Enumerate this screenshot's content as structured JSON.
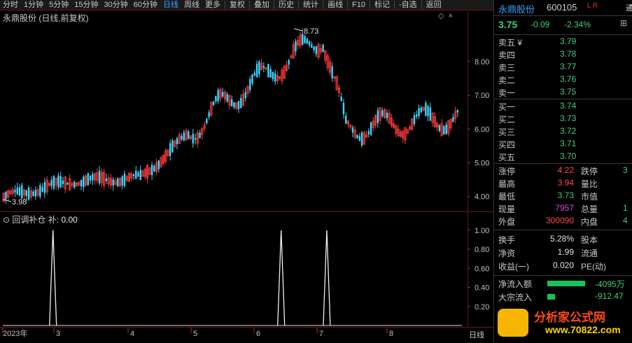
{
  "toolbar": {
    "periods": [
      "分时",
      "1分钟",
      "5分钟",
      "15分钟",
      "30分钟",
      "60分钟",
      "日线",
      "周线",
      "更多"
    ],
    "active_index": 6,
    "actions": [
      "复权",
      "叠加",
      "历史",
      "统计",
      "画线",
      "F10",
      "标记",
      "-自选",
      "返回"
    ]
  },
  "chart": {
    "title": "永鼎股份 (日线,前复权)",
    "high_marker": "8.73",
    "low_marker": "3.98",
    "y_ticks": [
      "8.00",
      "7.00",
      "6.00",
      "5.00",
      "4.00"
    ],
    "x_labels": [
      "2023年",
      "3",
      "4",
      "5",
      "6",
      "7",
      "8"
    ],
    "axis_caption": "日线",
    "colors": {
      "up": "#ff3b3b",
      "down": "#3ad7ff",
      "grid": "#5a1010"
    }
  },
  "indicator": {
    "name": "回调补仓",
    "label": "补:",
    "value": "0.00",
    "y_ticks": [
      "1.00",
      "0.80",
      "0.60",
      "0.40",
      "0.20"
    ]
  },
  "chart_data": [
    {
      "type": "bar",
      "title": "",
      "ylim": [
        3.6,
        9.2
      ],
      "x": [
        "2023-01",
        "2023-03",
        "2023-04",
        "2023-05",
        "2023-06",
        "2023-07",
        "2023-08"
      ],
      "values": [
        3.98,
        4.45,
        4.55,
        6.7,
        8.73,
        6.0,
        6.35
      ],
      "xlabel": "",
      "ylabel": ""
    },
    {
      "type": "line",
      "title": "",
      "ylim": [
        0,
        1.05
      ],
      "spikes": [
        {
          "position": 0.11,
          "value": 1.0
        },
        {
          "position": 0.61,
          "value": 1.0
        },
        {
          "position": 0.71,
          "value": 1.0
        }
      ],
      "xlabel": "",
      "ylabel": ""
    }
  ],
  "quote": {
    "name": "永鼎股份",
    "code": "600105",
    "lr": "L R",
    "extra": "通",
    "price": "3.75",
    "change": "-0.09",
    "pct": "-2.34%",
    "icon": "⊞"
  },
  "orderbook": {
    "asks": [
      {
        "label": "卖五 ¥",
        "price": "3.79"
      },
      {
        "label": "卖四",
        "price": "3.78"
      },
      {
        "label": "卖三",
        "price": "3.77"
      },
      {
        "label": "卖二",
        "price": "3.76"
      },
      {
        "label": "卖一",
        "price": "3.75"
      }
    ],
    "bids": [
      {
        "label": "买一",
        "price": "3.74"
      },
      {
        "label": "买二",
        "price": "3.73"
      },
      {
        "label": "买三",
        "price": "3.72"
      },
      {
        "label": "买四",
        "price": "3.71"
      },
      {
        "label": "买五",
        "price": "3.70"
      }
    ]
  },
  "stats": [
    {
      "l": "涨停",
      "v": "4.22",
      "vc": "red",
      "r": "跌停",
      "rv": "3"
    },
    {
      "l": "最高",
      "v": "3.94",
      "vc": "red",
      "r": "量比",
      "rv": ""
    },
    {
      "l": "最低",
      "v": "3.73",
      "vc": "green",
      "r": "市值",
      "rv": ""
    },
    {
      "l": "现量",
      "v": "7957",
      "vc": "purple",
      "r": "总量",
      "rv": "1"
    },
    {
      "l": "外盘",
      "v": "300090",
      "vc": "red",
      "r": "内盘",
      "rv": "4"
    },
    {
      "l": "换手",
      "v": "5.28%",
      "vc": "white",
      "r": "股本",
      "rv": ""
    },
    {
      "l": "净资",
      "v": "1.99",
      "vc": "white",
      "r": "流通",
      "rv": ""
    },
    {
      "l": "收益(一)",
      "v": "0.020",
      "vc": "white",
      "r": "PE(动)",
      "rv": ""
    }
  ],
  "flows": [
    {
      "label": "净流入额",
      "value": "-4095万",
      "bar": 0.45
    },
    {
      "label": "大宗流入",
      "value": "-912.47",
      "bar": 0.09
    }
  ],
  "logo": {
    "line1": "分析家公式网",
    "line2": "www.70822.com"
  }
}
